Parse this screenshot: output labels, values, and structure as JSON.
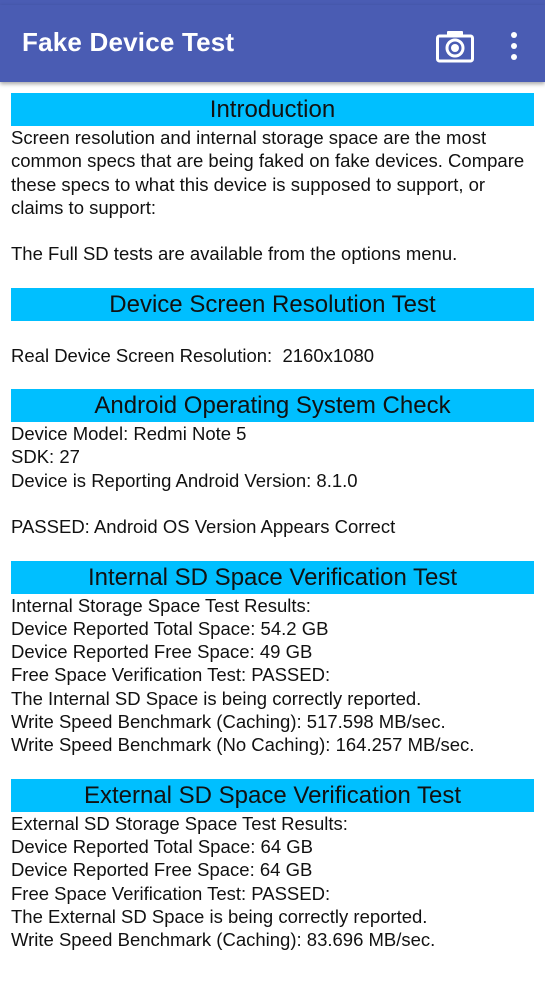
{
  "app_bar": {
    "title": "Fake Device Test",
    "color": "#4a5cb3",
    "actions": [
      {
        "icon": "camera-icon"
      },
      {
        "icon": "overflow-menu-icon"
      }
    ]
  },
  "colors": {
    "section_header_bg": "#00bfff",
    "text": "#111111",
    "background": "#ffffff"
  },
  "sections": {
    "intro": {
      "title": "Introduction",
      "paragraph": "Screen resolution and internal storage space are the most common specs that are being faked on fake devices. Compare these specs to what this device is supposed to support, or claims to support:",
      "note": "The Full SD tests are available from the options menu."
    },
    "screen": {
      "title": "Device Screen Resolution Test",
      "resolution_line": "Real Device Screen Resolution:  2160x1080"
    },
    "android": {
      "title": "Android Operating System Check",
      "lines": [
        "Device Model: Redmi Note 5",
        "SDK: 27",
        "Device is Reporting Android Version: 8.1.0"
      ],
      "result": "PASSED: Android OS Version Appears Correct"
    },
    "internal_sd": {
      "title": "Internal SD Space Verification Test",
      "lines": [
        "Internal Storage Space Test Results:",
        "Device Reported Total Space: 54.2 GB",
        "Device Reported Free Space: 49 GB",
        "Free Space Verification Test: PASSED:",
        "The Internal SD Space is being correctly reported.",
        "Write Speed Benchmark (Caching): 517.598 MB/sec.",
        "Write Speed Benchmark (No Caching): 164.257 MB/sec."
      ]
    },
    "external_sd": {
      "title": "External SD Space Verification Test",
      "lines": [
        "External SD Storage Space Test Results:",
        "Device Reported Total Space: 64 GB",
        "Device Reported Free Space: 64 GB",
        "Free Space Verification Test: PASSED:",
        "The External SD Space is being correctly reported.",
        "Write Speed Benchmark (Caching): 83.696 MB/sec."
      ]
    }
  }
}
